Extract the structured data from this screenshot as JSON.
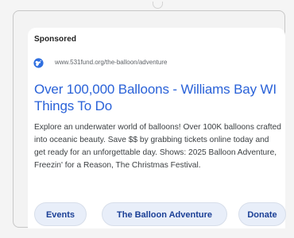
{
  "ad": {
    "sponsored_label": "Sponsored",
    "url": "www.531fund.org/the-balloon/adventure",
    "headline": "Over 100,000 Balloons - Williams Bay WI Things To Do",
    "description": "Explore an underwater world of balloons! Over 100K balloons crafted into oceanic beauty. Save $$ by grabbing tickets online today and get ready for an unforgettable day. Shows: 2025 Balloon Adventure, Freezin' for a Reason, The Christmas Festival.",
    "site_icon": "globe-icon"
  },
  "sitelinks": {
    "events": "Events",
    "balloon_adventure": "The Balloon Adventure",
    "donate": "Donate"
  },
  "colors": {
    "headline_blue": "#2a62d8",
    "chip_background": "#e8eef9",
    "chip_text": "#1a3f96",
    "icon_blue": "#2f6fe0"
  }
}
